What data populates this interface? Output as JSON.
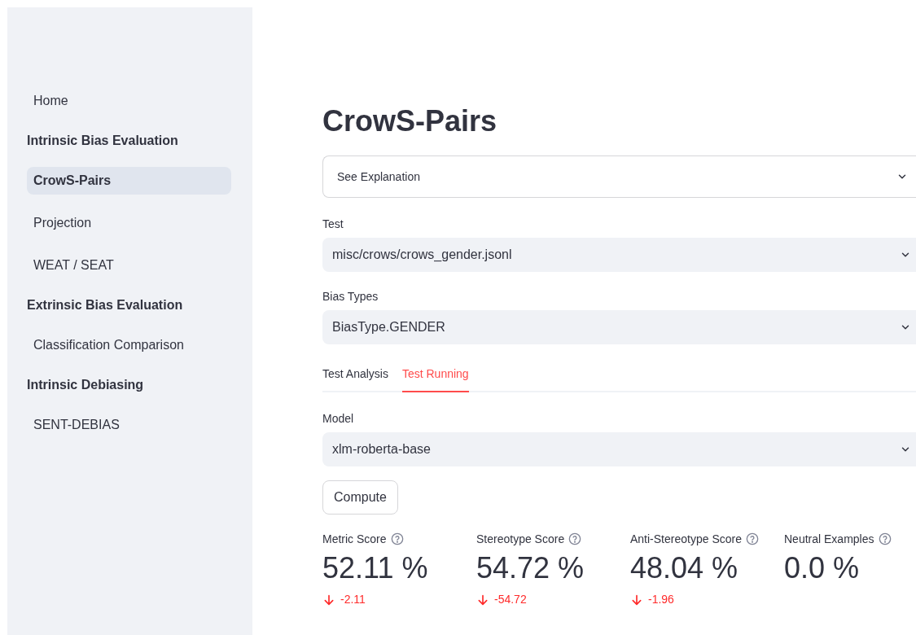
{
  "sidebar": {
    "items": [
      {
        "kind": "link",
        "label": "Home",
        "selected": false
      },
      {
        "kind": "heading",
        "label": "Intrinsic Bias Evaluation"
      },
      {
        "kind": "link",
        "label": "CrowS-Pairs",
        "selected": true
      },
      {
        "kind": "link",
        "label": "Projection",
        "selected": false
      },
      {
        "kind": "link",
        "label": "WEAT / SEAT",
        "selected": false
      },
      {
        "kind": "heading",
        "label": "Extrinsic Bias Evaluation"
      },
      {
        "kind": "link",
        "label": "Classification Comparison",
        "selected": false
      },
      {
        "kind": "heading",
        "label": "Intrinsic Debiasing"
      },
      {
        "kind": "link",
        "label": "SENT-DEBIAS",
        "selected": false
      }
    ]
  },
  "title": "CrowS-Pairs",
  "expander": {
    "label": "See Explanation",
    "expanded": false
  },
  "selects": [
    {
      "label": "Test",
      "value": "misc/crows/crows_gender.jsonl"
    },
    {
      "label": "Bias Types",
      "value": "BiasType.GENDER"
    }
  ],
  "tabs": [
    {
      "label": "Test Analysis",
      "selected": false
    },
    {
      "label": "Test Running",
      "selected": true
    }
  ],
  "model_select": {
    "label": "Model",
    "value": "xlm-roberta-base"
  },
  "compute_button": "Compute",
  "metrics": [
    {
      "label": "Metric Score",
      "value": "52.11 %",
      "delta": {
        "text": "-2.11",
        "kind": "down"
      }
    },
    {
      "label": "Stereotype Score",
      "value": "54.72 %",
      "delta": {
        "text": "-54.72",
        "kind": "down"
      }
    },
    {
      "label": "Anti-Stereotype Score",
      "value": "48.04 %",
      "delta": {
        "text": "-1.96",
        "kind": "down"
      }
    },
    {
      "label": "Neutral Examples",
      "value": "0.0 %"
    }
  ]
}
